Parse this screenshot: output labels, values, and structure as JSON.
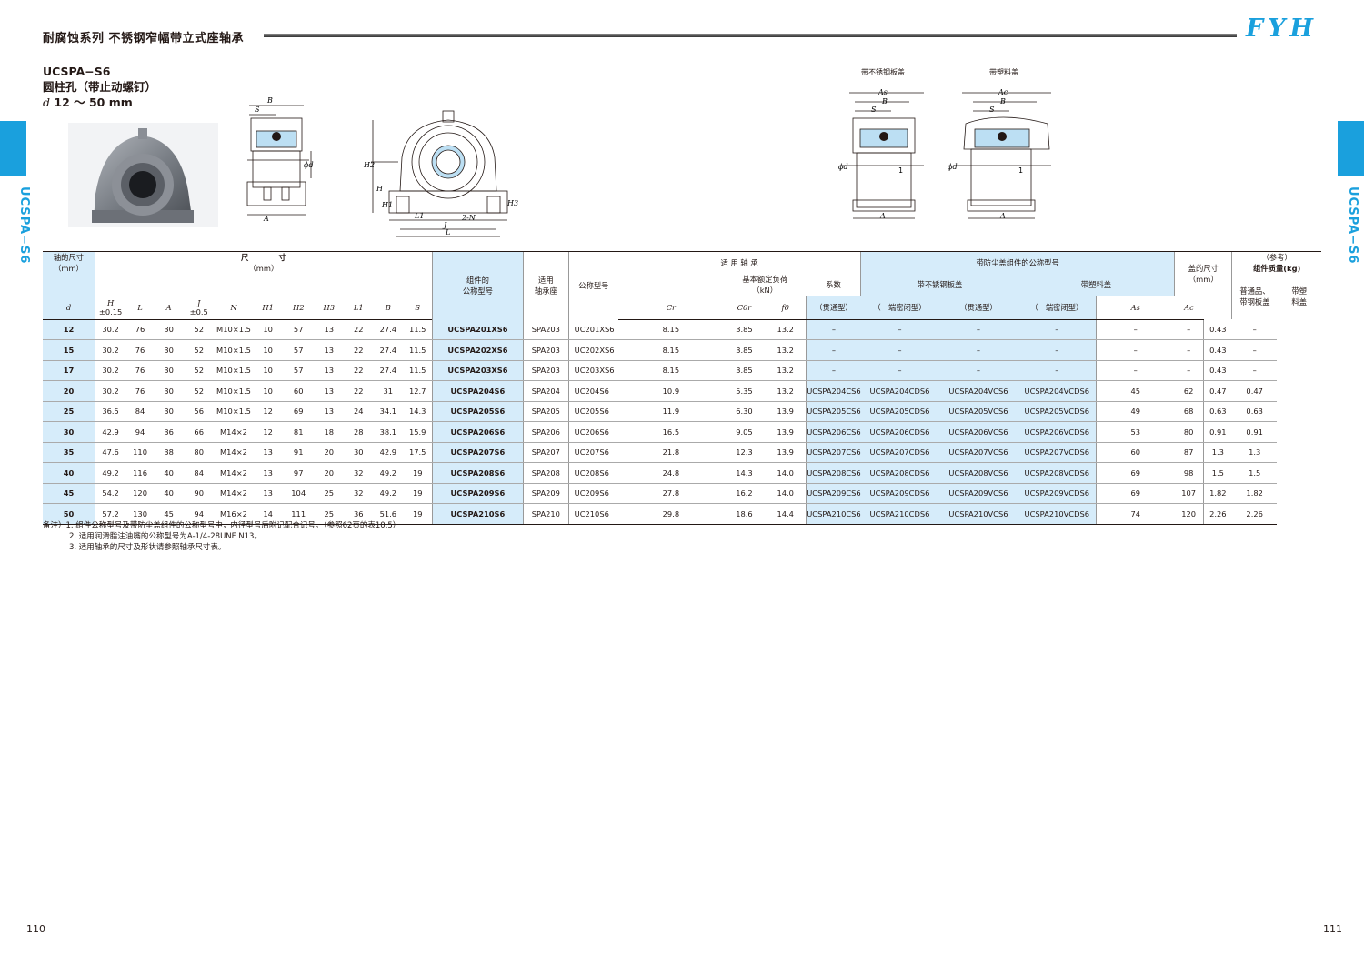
{
  "header": {
    "title": "耐腐蚀系列 不锈钢窄幅带立式座轴承",
    "logo": "FYH",
    "side_label": "UCSPA−S6"
  },
  "model": {
    "code": "UCSPA−S6",
    "bore_type": "圆柱孔（带止动螺钉）",
    "d_symbol": "d",
    "range": "12 ～ 50 mm"
  },
  "captions": {
    "stainless_cover": "带不锈钢板盖",
    "plastic_cover": "带塑料盖"
  },
  "drawing_labels": {
    "B": "B",
    "S": "S",
    "A": "A",
    "d": "ϕd",
    "H": "H",
    "H1": "H1",
    "H2": "H2",
    "H3": "H3",
    "L": "L",
    "L1": "L1",
    "J": "J",
    "N": "2-N",
    "As": "As",
    "Ac": "Ac",
    "one": "1"
  },
  "table_headers": {
    "shaft": "轴的尺寸",
    "shaft_unit": "（mm）",
    "dims": "尺　　　　寸",
    "dims_unit": "（mm）",
    "unit_no": "组件的\n公称型号",
    "housing": "适用\n轴承座",
    "bearing_no": "公称型号",
    "applicable": "适 用 轴 承",
    "load": "基本额定负荷",
    "load_unit": "（kN）",
    "factor": "系数",
    "cover_unit": "带防尘盖组件的公称型号",
    "stainless": "带不锈钢板盖",
    "plastic": "带塑料盖",
    "cover_dims": "盖的尺寸",
    "cover_dims_unit": "（mm）",
    "ref": "（参考）",
    "mass": "组件质量(kg)",
    "open": "（贯通型）",
    "closed": "（一端密闭型）",
    "mass_std": "普通品、\n带钢板盖",
    "mass_plastic": "带塑\n料盖",
    "d": "d",
    "H": "H",
    "H_tol": "±0.15",
    "L": "L",
    "A": "A",
    "J": "J",
    "J_tol": "±0.5",
    "N": "N",
    "H1": "H1",
    "H2": "H2",
    "H3": "H3",
    "L1": "L1",
    "B": "B",
    "S": "S",
    "Cr": "Cr",
    "C0r": "C0r",
    "f0": "f0",
    "As": "As",
    "Ac": "Ac"
  },
  "rows": [
    {
      "d": "12",
      "H": "30.2",
      "L": "76",
      "A": "30",
      "J": "52",
      "N": "M10×1.5",
      "H1": "10",
      "H2": "57",
      "H3": "13",
      "L1": "22",
      "B": "27.4",
      "S": "11.5",
      "unit": "UCSPA201XS6",
      "housing": "SPA203",
      "bearing": "UC201XS6",
      "Cr": "8.15",
      "C0r": "3.85",
      "f0": "13.2",
      "sc": "–",
      "scd": "–",
      "vc": "–",
      "vcd": "–",
      "As": "–",
      "Ac": "–",
      "m1": "0.43",
      "m2": "–"
    },
    {
      "d": "15",
      "H": "30.2",
      "L": "76",
      "A": "30",
      "J": "52",
      "N": "M10×1.5",
      "H1": "10",
      "H2": "57",
      "H3": "13",
      "L1": "22",
      "B": "27.4",
      "S": "11.5",
      "unit": "UCSPA202XS6",
      "housing": "SPA203",
      "bearing": "UC202XS6",
      "Cr": "8.15",
      "C0r": "3.85",
      "f0": "13.2",
      "sc": "–",
      "scd": "–",
      "vc": "–",
      "vcd": "–",
      "As": "–",
      "Ac": "–",
      "m1": "0.43",
      "m2": "–"
    },
    {
      "d": "17",
      "H": "30.2",
      "L": "76",
      "A": "30",
      "J": "52",
      "N": "M10×1.5",
      "H1": "10",
      "H2": "57",
      "H3": "13",
      "L1": "22",
      "B": "27.4",
      "S": "11.5",
      "unit": "UCSPA203XS6",
      "housing": "SPA203",
      "bearing": "UC203XS6",
      "Cr": "8.15",
      "C0r": "3.85",
      "f0": "13.2",
      "sc": "–",
      "scd": "–",
      "vc": "–",
      "vcd": "–",
      "As": "–",
      "Ac": "–",
      "m1": "0.43",
      "m2": "–"
    },
    {
      "d": "20",
      "H": "30.2",
      "L": "76",
      "A": "30",
      "J": "52",
      "N": "M10×1.5",
      "H1": "10",
      "H2": "60",
      "H3": "13",
      "L1": "22",
      "B": "31",
      "S": "12.7",
      "unit": "UCSPA204S6",
      "housing": "SPA204",
      "bearing": "UC204S6",
      "Cr": "10.9",
      "C0r": "5.35",
      "f0": "13.2",
      "sc": "UCSPA204CS6",
      "scd": "UCSPA204CDS6",
      "vc": "UCSPA204VCS6",
      "vcd": "UCSPA204VCDS6",
      "As": "45",
      "Ac": "62",
      "m1": "0.47",
      "m2": "0.47"
    },
    {
      "d": "25",
      "H": "36.5",
      "L": "84",
      "A": "30",
      "J": "56",
      "N": "M10×1.5",
      "H1": "12",
      "H2": "69",
      "H3": "13",
      "L1": "24",
      "B": "34.1",
      "S": "14.3",
      "unit": "UCSPA205S6",
      "housing": "SPA205",
      "bearing": "UC205S6",
      "Cr": "11.9",
      "C0r": "6.30",
      "f0": "13.9",
      "sc": "UCSPA205CS6",
      "scd": "UCSPA205CDS6",
      "vc": "UCSPA205VCS6",
      "vcd": "UCSPA205VCDS6",
      "As": "49",
      "Ac": "68",
      "m1": "0.63",
      "m2": "0.63"
    },
    {
      "d": "30",
      "H": "42.9",
      "L": "94",
      "A": "36",
      "J": "66",
      "N": "M14×2",
      "H1": "12",
      "H2": "81",
      "H3": "18",
      "L1": "28",
      "B": "38.1",
      "S": "15.9",
      "unit": "UCSPA206S6",
      "housing": "SPA206",
      "bearing": "UC206S6",
      "Cr": "16.5",
      "C0r": "9.05",
      "f0": "13.9",
      "sc": "UCSPA206CS6",
      "scd": "UCSPA206CDS6",
      "vc": "UCSPA206VCS6",
      "vcd": "UCSPA206VCDS6",
      "As": "53",
      "Ac": "80",
      "m1": "0.91",
      "m2": "0.91"
    },
    {
      "d": "35",
      "H": "47.6",
      "L": "110",
      "A": "38",
      "J": "80",
      "N": "M14×2",
      "H1": "13",
      "H2": "91",
      "H3": "20",
      "L1": "30",
      "B": "42.9",
      "S": "17.5",
      "unit": "UCSPA207S6",
      "housing": "SPA207",
      "bearing": "UC207S6",
      "Cr": "21.8",
      "C0r": "12.3",
      "f0": "13.9",
      "sc": "UCSPA207CS6",
      "scd": "UCSPA207CDS6",
      "vc": "UCSPA207VCS6",
      "vcd": "UCSPA207VCDS6",
      "As": "60",
      "Ac": "87",
      "m1": "1.3",
      "m2": "1.3"
    },
    {
      "d": "40",
      "H": "49.2",
      "L": "116",
      "A": "40",
      "J": "84",
      "N": "M14×2",
      "H1": "13",
      "H2": "97",
      "H3": "20",
      "L1": "32",
      "B": "49.2",
      "S": "19",
      "unit": "UCSPA208S6",
      "housing": "SPA208",
      "bearing": "UC208S6",
      "Cr": "24.8",
      "C0r": "14.3",
      "f0": "14.0",
      "sc": "UCSPA208CS6",
      "scd": "UCSPA208CDS6",
      "vc": "UCSPA208VCS6",
      "vcd": "UCSPA208VCDS6",
      "As": "69",
      "Ac": "98",
      "m1": "1.5",
      "m2": "1.5"
    },
    {
      "d": "45",
      "H": "54.2",
      "L": "120",
      "A": "40",
      "J": "90",
      "N": "M14×2",
      "H1": "13",
      "H2": "104",
      "H3": "25",
      "L1": "32",
      "B": "49.2",
      "S": "19",
      "unit": "UCSPA209S6",
      "housing": "SPA209",
      "bearing": "UC209S6",
      "Cr": "27.8",
      "C0r": "16.2",
      "f0": "14.0",
      "sc": "UCSPA209CS6",
      "scd": "UCSPA209CDS6",
      "vc": "UCSPA209VCS6",
      "vcd": "UCSPA209VCDS6",
      "As": "69",
      "Ac": "107",
      "m1": "1.82",
      "m2": "1.82"
    },
    {
      "d": "50",
      "H": "57.2",
      "L": "130",
      "A": "45",
      "J": "94",
      "N": "M16×2",
      "H1": "14",
      "H2": "111",
      "H3": "25",
      "L1": "36",
      "B": "51.6",
      "S": "19",
      "unit": "UCSPA210S6",
      "housing": "SPA210",
      "bearing": "UC210S6",
      "Cr": "29.8",
      "C0r": "18.6",
      "f0": "14.4",
      "sc": "UCSPA210CS6",
      "scd": "UCSPA210CDS6",
      "vc": "UCSPA210VCS6",
      "vcd": "UCSPA210VCDS6",
      "As": "74",
      "Ac": "120",
      "m1": "2.26",
      "m2": "2.26"
    }
  ],
  "notes": [
    "备注）1. 组件公称型号及带防尘盖组件的公称型号中，内径型号后附记配合记号。（参照62页的表10.5）",
    "2. 适用润滑脂注油嘴的公称型号为A-1/4-28UNF N13。",
    "3. 适用轴承的尺寸及形状请参照轴承尺寸表。"
  ],
  "pages": {
    "left": "110",
    "right": "111"
  }
}
